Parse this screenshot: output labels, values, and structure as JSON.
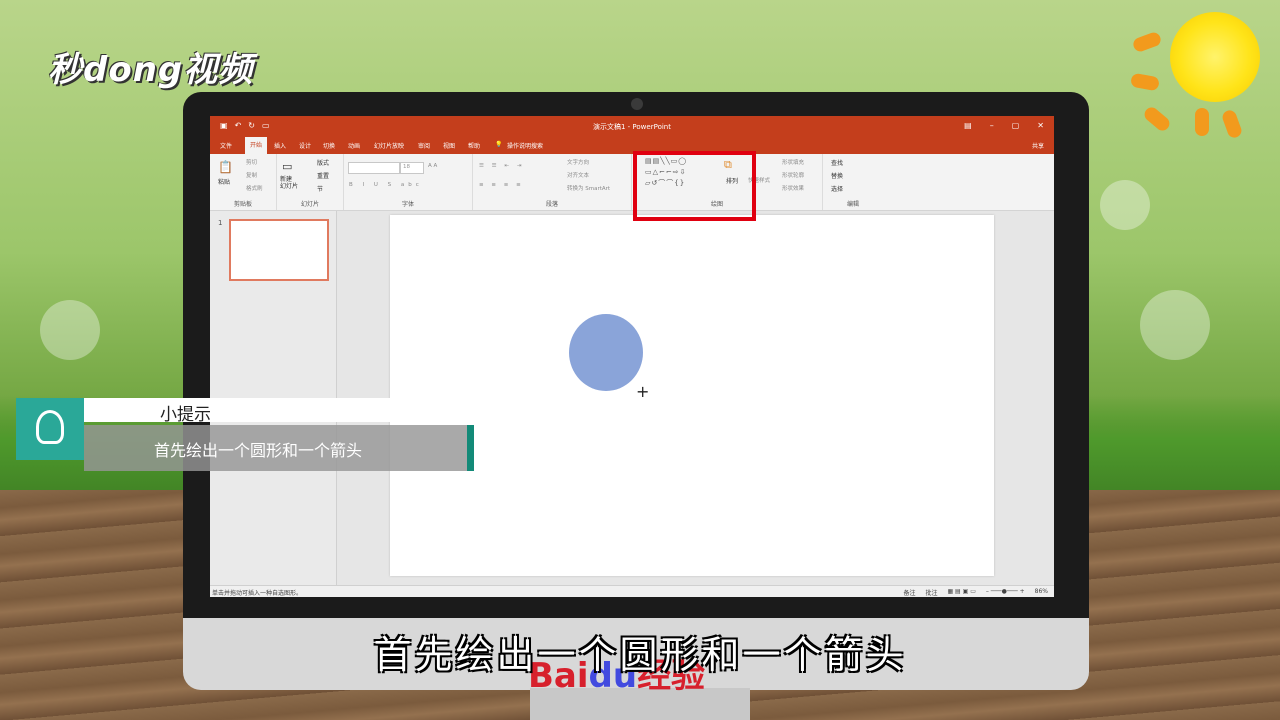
{
  "branding": {
    "logo": "秒dong视频",
    "watermark_bai": "Bai",
    "watermark_du": "du",
    "watermark_tail": "经验"
  },
  "window": {
    "title": "演示文稿1 - PowerPoint"
  },
  "tabs": [
    "文件",
    "开始",
    "插入",
    "设计",
    "切换",
    "动画",
    "幻灯片放映",
    "审阅",
    "视图",
    "帮助",
    "操作说明搜索"
  ],
  "active_tab": "开始",
  "share_label": "共享",
  "ribbon": {
    "clipboard": {
      "paste": "粘贴",
      "cut": "剪切",
      "copy": "复制",
      "format_painter": "格式刷",
      "label": "剪贴板"
    },
    "slides": {
      "new_slide": "新建\n幻灯片",
      "layout": "版式",
      "reset": "重置",
      "section": "节",
      "label": "幻灯片"
    },
    "font": {
      "size": "18",
      "label": "字体"
    },
    "paragraph": {
      "text_direction": "文字方向",
      "align_text": "对齐文本",
      "smartart": "转换为 SmartArt",
      "label": "段落"
    },
    "drawing": {
      "arrange": "排列",
      "quick_styles": "快速样式",
      "shape_fill": "形状填充",
      "shape_outline": "形状轮廓",
      "shape_effects": "形状效果",
      "label": "绘图"
    },
    "editing": {
      "find": "查找",
      "replace": "替换",
      "select": "选择",
      "label": "编辑"
    }
  },
  "slide_panel": {
    "slide_number": "1"
  },
  "status": {
    "hint": "单击并拖动可插入一种自选图形。",
    "notes": "备注",
    "comments": "批注",
    "zoom": "86%"
  },
  "tip": {
    "title": "小提示",
    "body": "首先绘出一个圆形和一个箭头"
  },
  "subtitle": "首先绘出一个圆形和一个箭头",
  "colors": {
    "ppt_red": "#c43e1c",
    "shape_fill": "#8aa4d9",
    "highlight": "#e00010",
    "tip_teal": "#2aa898"
  }
}
